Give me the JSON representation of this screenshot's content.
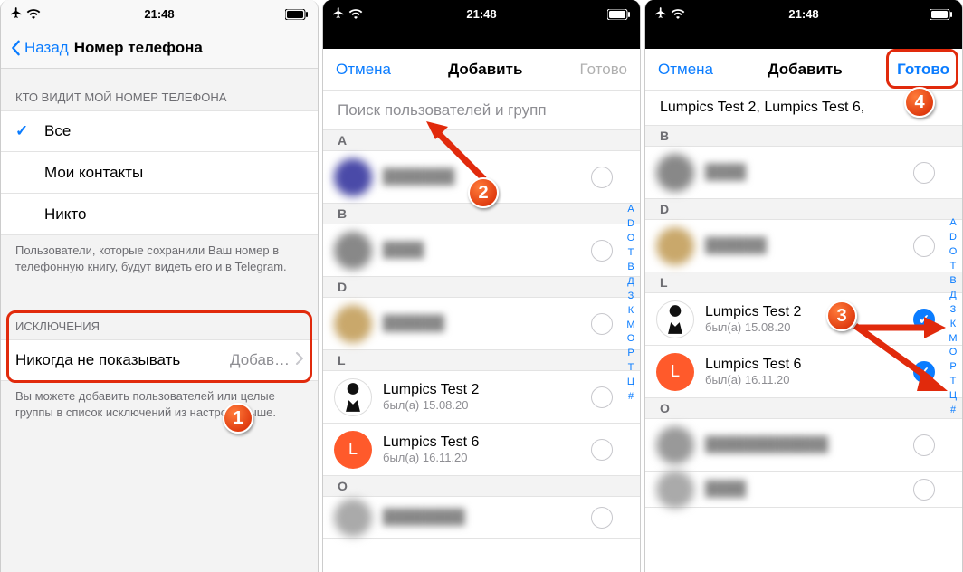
{
  "status": {
    "time": "21:48"
  },
  "s1": {
    "back": "Назад",
    "title": "Номер телефона",
    "who_header": "КТО ВИДИТ МОЙ НОМЕР ТЕЛЕФОНА",
    "opt1": "Все",
    "opt2": "Мои контакты",
    "opt3": "Никто",
    "who_note": "Пользователи, которые сохранили Ваш номер в телефонную книгу, будут видеть его и в Telegram.",
    "exc_header": "ИСКЛЮЧЕНИЯ",
    "never_show": "Никогда не показывать",
    "add": "Добав…",
    "exc_note": "Вы можете добавить пользователей или целые группы в список исключений из настроек выше."
  },
  "s2": {
    "cancel": "Отмена",
    "title": "Добавить",
    "done": "Готово",
    "search_ph": "Поиск пользователей и групп",
    "sections": {
      "A": [
        {
          "name": "",
          "sub": "",
          "blur": true
        }
      ],
      "B": [
        {
          "name": "",
          "sub": "",
          "blur": true
        }
      ],
      "D": [
        {
          "name": "",
          "sub": "",
          "blur": true
        }
      ],
      "L": [
        {
          "name": "Lumpics Test 2",
          "sub": "был(а) 15.08.20",
          "avatar": "suit"
        },
        {
          "name": "Lumpics Test 6",
          "sub": "был(а) 16.11.20",
          "avatar": "L"
        }
      ],
      "O": [
        {
          "name": "",
          "sub": "",
          "blur": true
        }
      ]
    },
    "index": [
      "A",
      "D",
      "O",
      "T",
      "В",
      "Д",
      "З",
      "К",
      "М",
      "О",
      "Р",
      "Т",
      "Ц",
      "#"
    ]
  },
  "s3": {
    "cancel": "Отмена",
    "title": "Добавить",
    "done": "Готово",
    "selected": "Lumpics Test 2,  Lumpics Test 6,",
    "sections": {
      "B": [
        {
          "name": "",
          "sub": "",
          "blur": true
        }
      ],
      "D": [
        {
          "name": "",
          "sub": "",
          "blur": true
        }
      ],
      "L": [
        {
          "name": "Lumpics Test 2",
          "sub": "был(а) 15.08.20",
          "avatar": "suit",
          "checked": true
        },
        {
          "name": "Lumpics Test 6",
          "sub": "был(а) 16.11.20",
          "avatar": "L",
          "checked": true
        }
      ],
      "O": [
        {
          "name": "",
          "sub": "",
          "blur": true
        },
        {
          "name": "",
          "sub": "",
          "blur": true
        }
      ]
    },
    "index": [
      "A",
      "D",
      "O",
      "T",
      "В",
      "Д",
      "З",
      "К",
      "М",
      "О",
      "Р",
      "Т",
      "Ц",
      "#"
    ]
  },
  "callouts": {
    "n1": "1",
    "n2": "2",
    "n3": "3",
    "n4": "4"
  }
}
